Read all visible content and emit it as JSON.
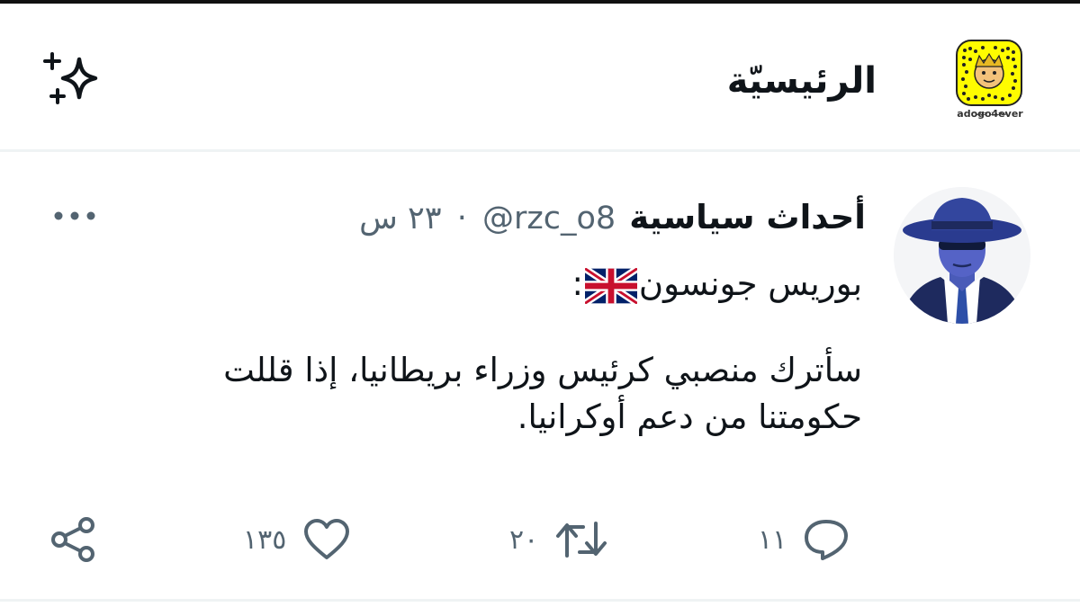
{
  "header": {
    "title": "الرئيسيّة",
    "sparkle_icon": "sparkle-icon",
    "snapcode_username": "adogo4ever"
  },
  "tweet": {
    "author_name": "أحداث سياسية",
    "handle": "@rzc_o8",
    "separator": "·",
    "time": "٢٣ س",
    "body_line1_name": "بوريس جونسون",
    "body_line1_suffix": ":",
    "body_paragraph": "سأترك منصبي كرئيس وزراء بريطانيا، إذا قللت حكومتنا من دعم أوكرانيا.",
    "flag_icon": "uk-flag-icon",
    "more_icon": "more-dots-icon"
  },
  "actions": {
    "reply_count": "١١",
    "retweet_count": "٢٠",
    "like_count": "١٣٥",
    "share_label": ""
  },
  "colors": {
    "text_primary": "#0f1419",
    "text_secondary": "#536471",
    "divider": "#eff3f4",
    "snapcode_yellow": "#fffc00"
  }
}
